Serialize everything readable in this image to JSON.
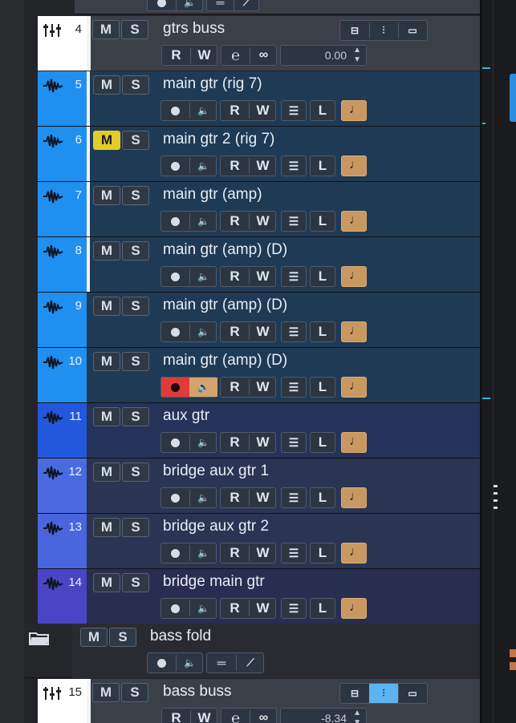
{
  "header": {
    "partial_controls": [
      "record",
      "monitor",
      "list",
      "automation"
    ]
  },
  "colors": {
    "buss_strip": "#ffffff",
    "audio_light": "#1f8ff0",
    "audio_mid": "#2560e6",
    "audio_violet": "#4a55cc",
    "track_body": "#1f3a55",
    "track_body_violet": "#2a3556",
    "buss_body": "#3b3f48",
    "mute_active": "#e2cc2a",
    "record_active": "#e03b3b",
    "monitor_active": "#d3a36b",
    "note_orange": "#c99861",
    "right_marker": "#2fb7d6"
  },
  "buss_tracks": [
    {
      "number": "4",
      "icon": "buss-fader-icon",
      "name": "gtrs buss",
      "mute": "M",
      "solo": "S",
      "read": "R",
      "write": "W",
      "volume": "0.00"
    },
    {
      "number": "15",
      "icon": "buss-fader-icon",
      "name": "bass buss",
      "mute": "M",
      "solo": "S",
      "read": "R",
      "write": "W",
      "volume": "-8.34"
    }
  ],
  "audio_tracks": [
    {
      "number": "5",
      "name": "main gtr (rig 7)",
      "mute_active": false,
      "record_active": false
    },
    {
      "number": "6",
      "name": "main gtr 2 (rig 7)",
      "mute_active": true,
      "record_active": false
    },
    {
      "number": "7",
      "name": "main gtr (amp)",
      "mute_active": false,
      "record_active": false
    },
    {
      "number": "8",
      "name": "main gtr (amp) (D)",
      "mute_active": false,
      "record_active": false
    },
    {
      "number": "9",
      "name": "main gtr (amp) (D)",
      "mute_active": false,
      "record_active": false
    },
    {
      "number": "10",
      "name": "main gtr (amp) (D)",
      "mute_active": false,
      "record_active": true
    },
    {
      "number": "11",
      "name": "aux gtr",
      "mute_active": false,
      "record_active": false
    },
    {
      "number": "12",
      "name": "bridge aux gtr 1",
      "mute_active": false,
      "record_active": false
    },
    {
      "number": "13",
      "name": "bridge aux gtr 2",
      "mute_active": false,
      "record_active": false
    },
    {
      "number": "14",
      "name": "bridge main gtr",
      "mute_active": false,
      "record_active": false
    }
  ],
  "labels": {
    "mute": "M",
    "solo": "S",
    "read": "R",
    "write": "W",
    "lane": "L"
  },
  "folder": {
    "name": "bass fold",
    "mute": "M",
    "solo": "S",
    "icon": "folder-icon"
  }
}
